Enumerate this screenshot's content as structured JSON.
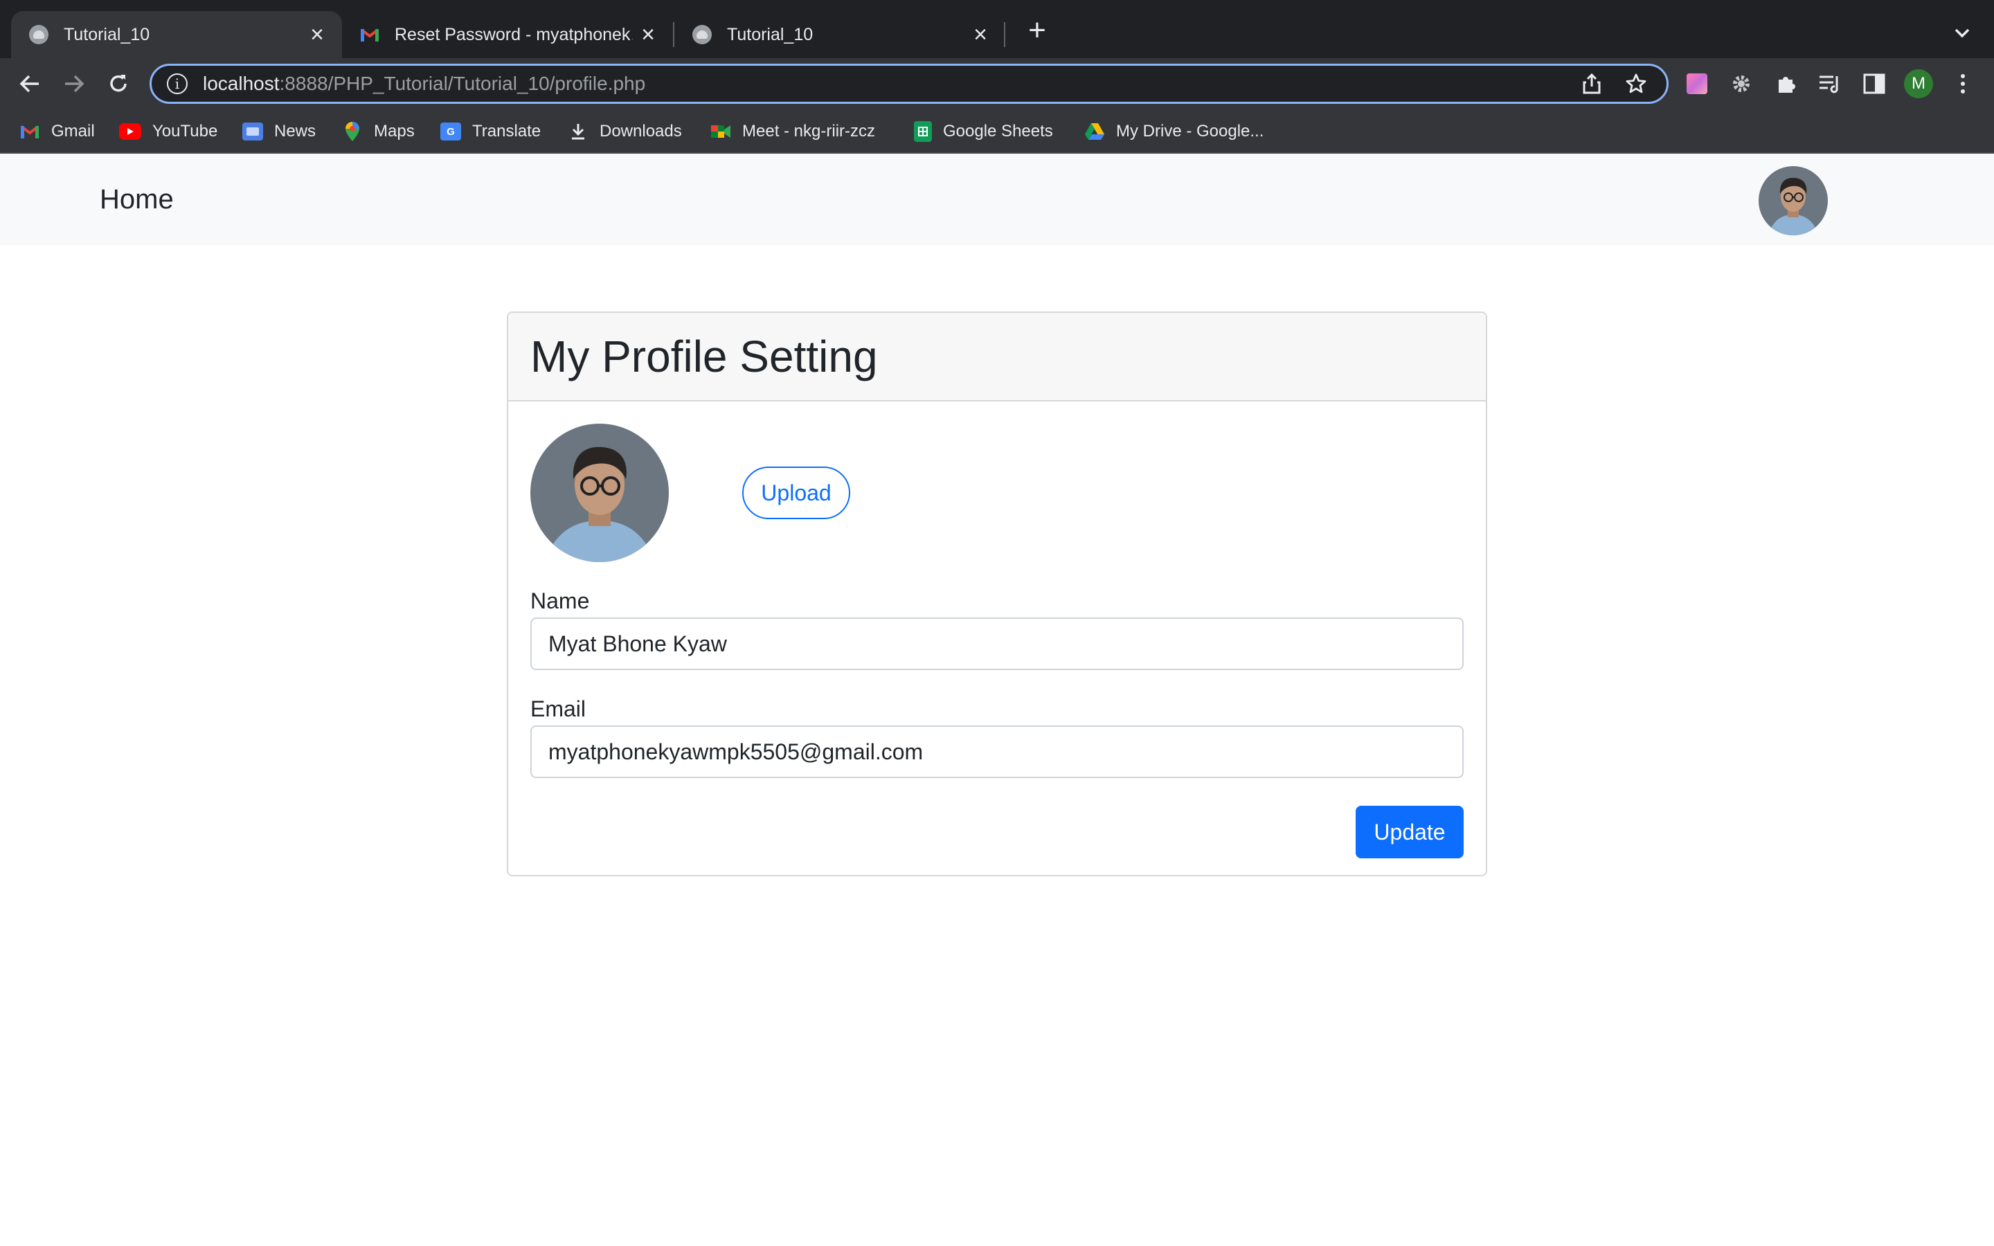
{
  "browser": {
    "tabs": [
      {
        "title": "Tutorial_10",
        "active": true
      },
      {
        "title": "Reset Password - myatphonek…",
        "active": false
      },
      {
        "title": "Tutorial_10",
        "active": false
      }
    ],
    "url_host": "localhost",
    "url_rest": ":8888/PHP_Tutorial/Tutorial_10/profile.php",
    "profile_initial": "M",
    "bookmarks": [
      {
        "label": "Gmail",
        "icon": "gmail-icon"
      },
      {
        "label": "YouTube",
        "icon": "youtube-icon"
      },
      {
        "label": "News",
        "icon": "news-icon"
      },
      {
        "label": "Maps",
        "icon": "maps-icon"
      },
      {
        "label": "Translate",
        "icon": "translate-icon"
      },
      {
        "label": "Downloads",
        "icon": "download-icon"
      },
      {
        "label": "Meet - nkg-riir-zcz",
        "icon": "meet-icon"
      },
      {
        "label": "Google Sheets",
        "icon": "sheets-icon"
      },
      {
        "label": "My Drive - Google...",
        "icon": "drive-icon"
      }
    ]
  },
  "navbar": {
    "brand": "Home"
  },
  "card": {
    "title": "My Profile Setting",
    "upload_label": "Upload",
    "name_label": "Name",
    "name_value": "Myat Bhone Kyaw",
    "email_label": "Email",
    "email_value": "myatphonekyawmpk5505@gmail.com",
    "update_label": "Update"
  },
  "colors": {
    "primary": "#0d6efd",
    "navbar_bg": "#f8f9fa",
    "chrome_dark": "#202124",
    "chrome_toolbar": "#35363a",
    "omnibox_focus": "#8ab4f8"
  }
}
